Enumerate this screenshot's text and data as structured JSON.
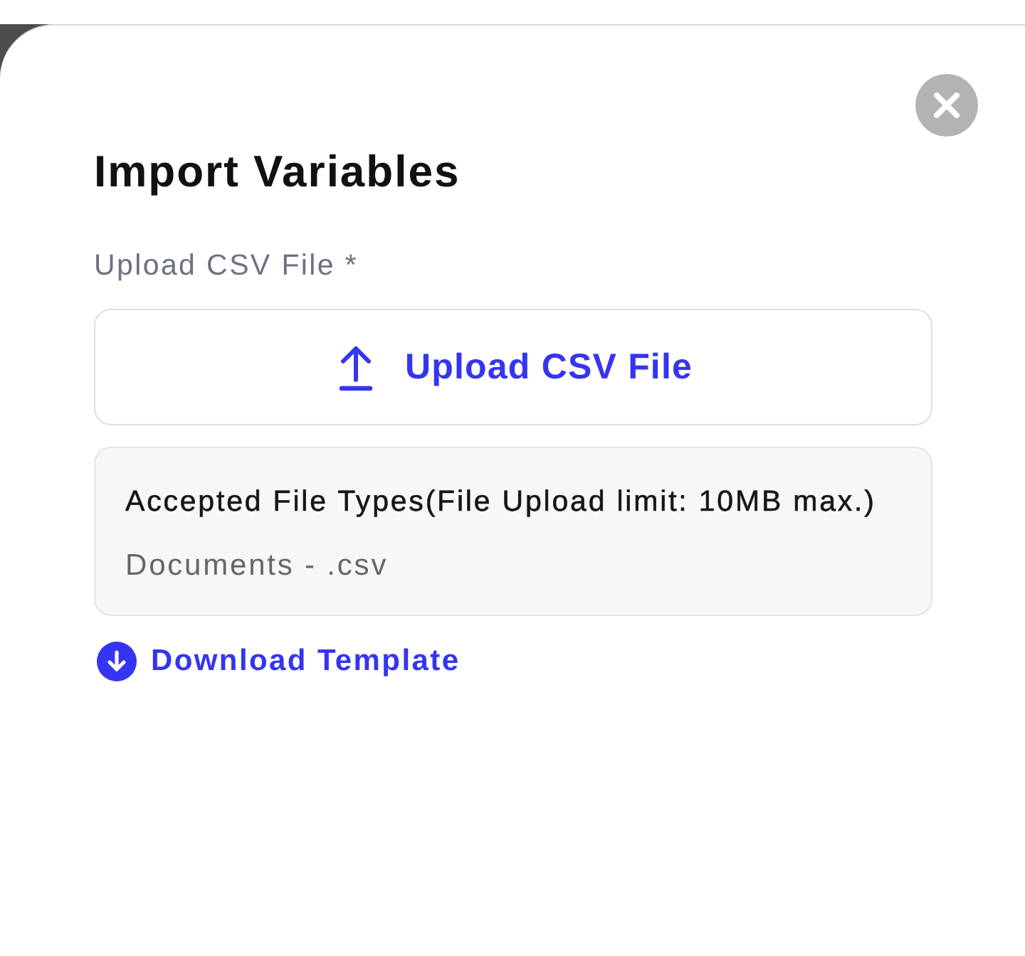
{
  "dialog": {
    "title": "Import Variables"
  },
  "upload_field": {
    "label": "Upload CSV File *",
    "button_label": "Upload CSV File"
  },
  "file_info": {
    "heading": "Accepted File Types(File Upload limit: 10MB max.)",
    "types": "Documents - .csv"
  },
  "download_link": {
    "label": "Download Template"
  }
}
